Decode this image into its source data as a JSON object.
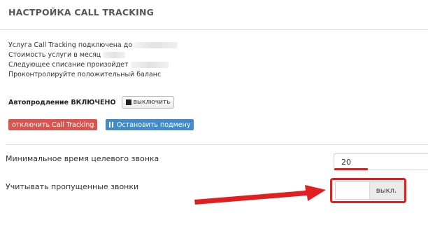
{
  "header": {
    "title": "НАСТРОЙКА CALL TRACKING"
  },
  "info": {
    "lines": [
      "Услуга Call Tracking подключена до",
      "Стоимость услуги в месяц",
      "Следующее списание произойдет",
      "Проконтролируйте положительный баланс"
    ]
  },
  "autorenew": {
    "label": "Автопродление ВКЛЮЧЕНО",
    "button_label": "выключить"
  },
  "actions": {
    "disable_label": "отключить Call Tracking",
    "stop_label": "Остановить подмену"
  },
  "settings": {
    "min_time_label": "Минимальное время целевого звонка",
    "min_time_value": "20",
    "missed_calls_label": "Учитывать пропущенные звонки",
    "missed_calls_state": "выкл."
  },
  "colors": {
    "danger": "#d9534f",
    "primary": "#428bca",
    "annotation_red": "#e02020"
  }
}
